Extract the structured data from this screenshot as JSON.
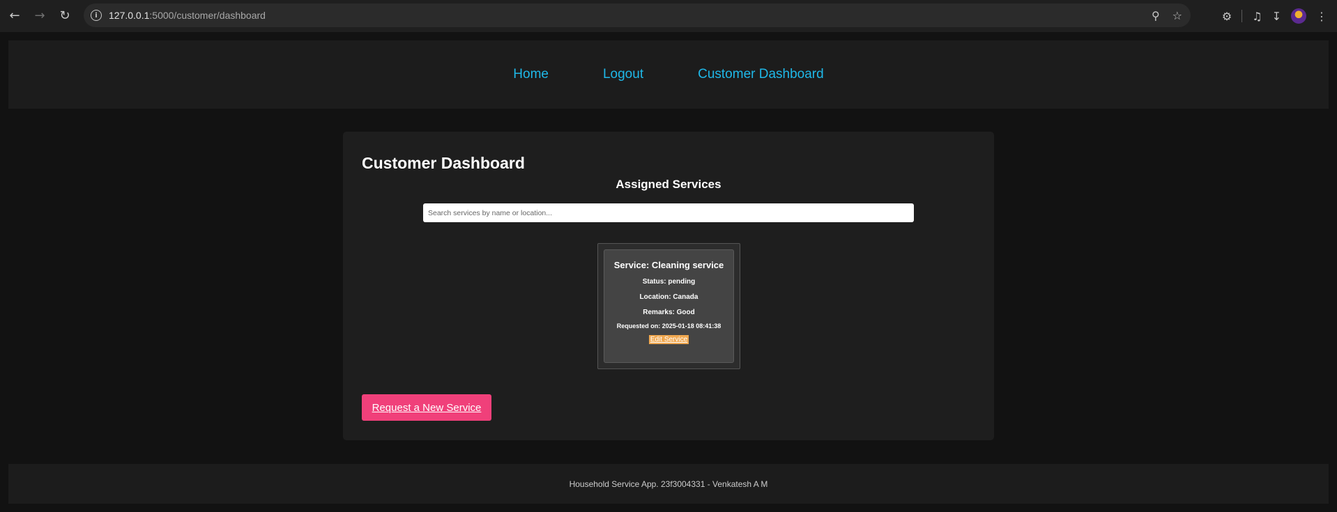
{
  "browser": {
    "url_host": "127.0.0.1",
    "url_path": ":5000/customer/dashboard",
    "back_icon": "arrow-left-icon",
    "forward_icon": "arrow-right-icon",
    "reload_icon": "reload-icon"
  },
  "nav": {
    "links": [
      {
        "label": "Home"
      },
      {
        "label": "Logout"
      },
      {
        "label": "Customer Dashboard"
      }
    ]
  },
  "main": {
    "title": "Customer Dashboard",
    "section_title": "Assigned Services",
    "search_placeholder": "Search services by name or location...",
    "services": [
      {
        "title": "Service: Cleaning service",
        "status": "Status: pending",
        "location": "Location: Canada",
        "remarks": "Remarks: Good",
        "requested": "Requested on: 2025-01-18 08:41:38",
        "edit_label": "Edit Service"
      }
    ],
    "request_button": "Request a New Service"
  },
  "footer": {
    "text": "Household Service App. 23f3004331 - Venkatesh A M"
  },
  "colors": {
    "link": "#1fb8e8",
    "request_button": "#f0407a",
    "edit_button": "#f0a850"
  }
}
